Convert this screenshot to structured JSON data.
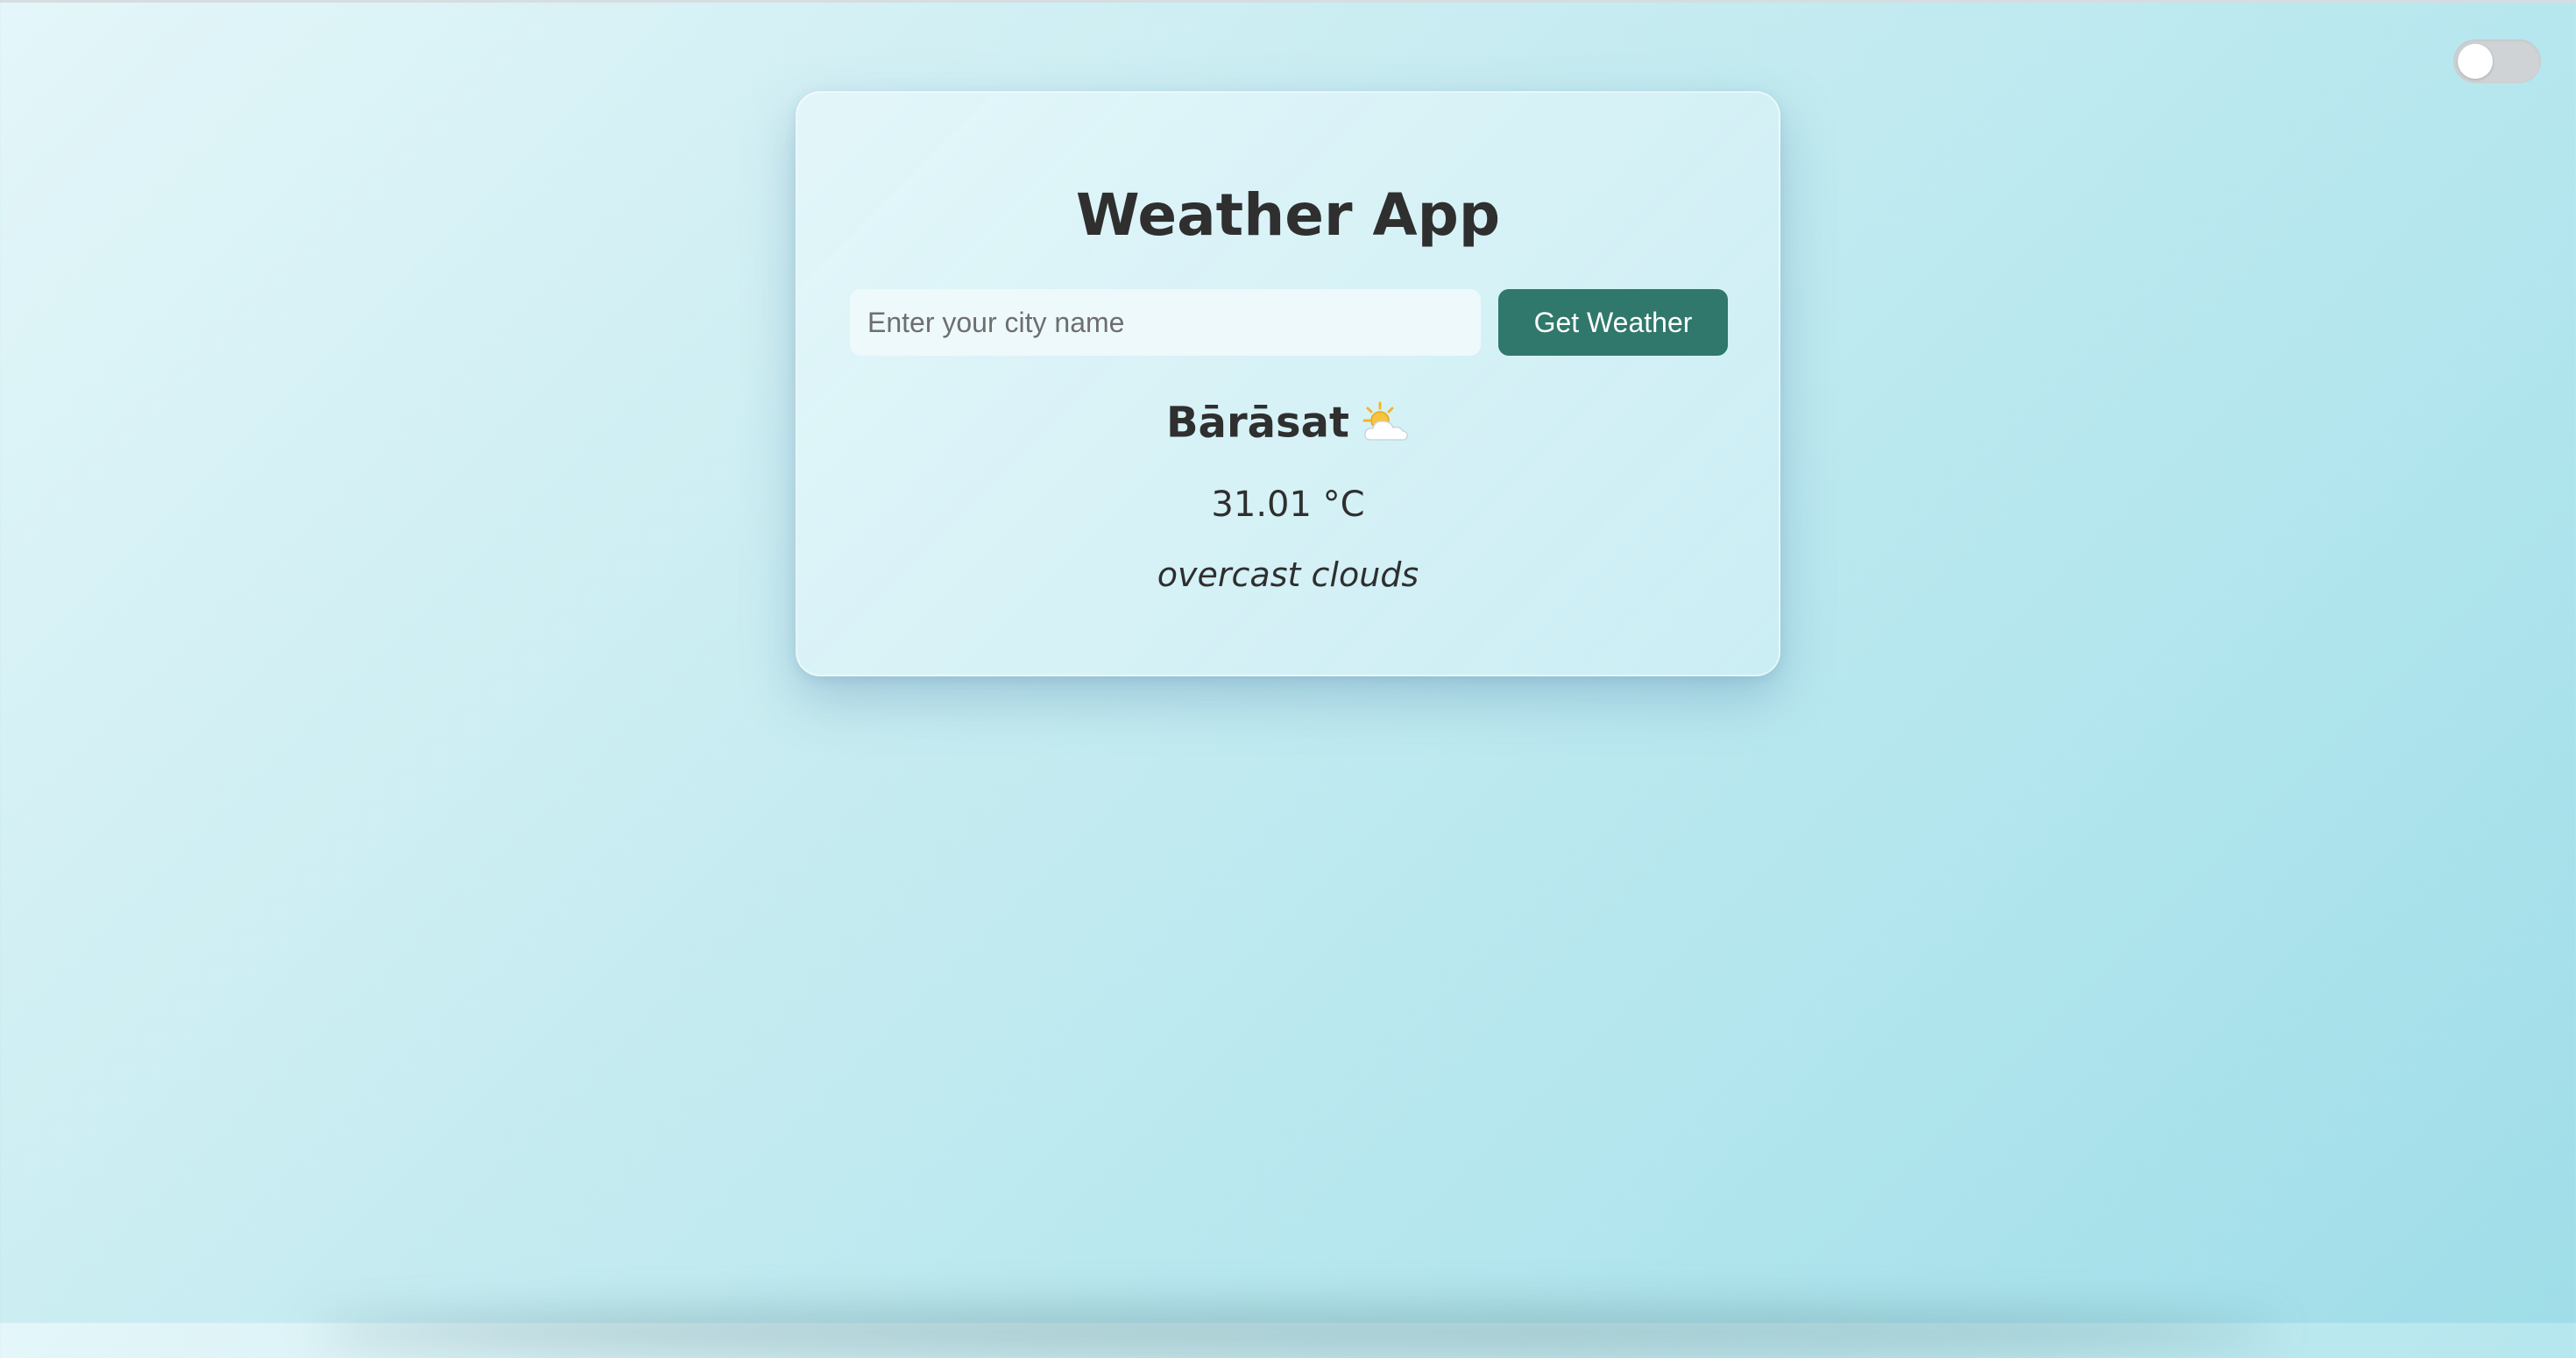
{
  "app": {
    "title": "Weather App"
  },
  "search": {
    "placeholder": "Enter your city name",
    "value": "",
    "button_label": "Get Weather"
  },
  "weather": {
    "city": "Bārāsat",
    "icon": "sun-behind-cloud-icon",
    "temperature": "31.01 °C",
    "description": "overcast clouds"
  },
  "theme_toggle": {
    "state": "off"
  },
  "colors": {
    "button": "#2f786b",
    "text": "#2f2f2f",
    "background_start": "#e4f6f9",
    "background_end": "#9fdde8"
  }
}
